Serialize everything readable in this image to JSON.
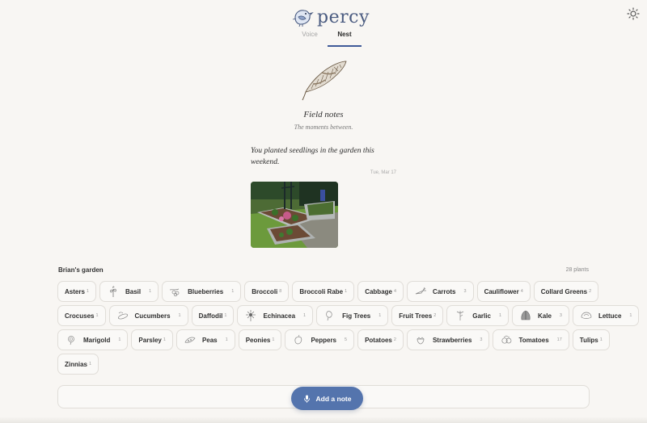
{
  "app": {
    "name": "percy"
  },
  "tabs": [
    {
      "label": "Voice",
      "active": false
    },
    {
      "label": "Nest",
      "active": true
    }
  ],
  "field_notes": {
    "title": "Field notes",
    "subtitle": "The moments between."
  },
  "note": {
    "text": "You planted seedlings in the garden this weekend.",
    "date": "Tue, Mar 17"
  },
  "garden": {
    "title": "Brian's garden",
    "count": "28 plants",
    "plants": [
      {
        "name": "Asters",
        "count": "1",
        "icon": null
      },
      {
        "name": "Basil",
        "count": "1",
        "icon": "basil-icon"
      },
      {
        "name": "Blueberries",
        "count": "1",
        "icon": "blueberries-icon"
      },
      {
        "name": "Broccoli",
        "count": "8",
        "icon": null
      },
      {
        "name": "Broccoli Rabe",
        "count": "1",
        "icon": null
      },
      {
        "name": "Cabbage",
        "count": "4",
        "icon": null
      },
      {
        "name": "Carrots",
        "count": "3",
        "icon": "carrots-icon"
      },
      {
        "name": "Cauliflower",
        "count": "4",
        "icon": null
      },
      {
        "name": "Collard Greens",
        "count": "2",
        "icon": null
      },
      {
        "name": "Crocuses",
        "count": "1",
        "icon": null
      },
      {
        "name": "Cucumbers",
        "count": "1",
        "icon": "cucumbers-icon"
      },
      {
        "name": "Daffodil",
        "count": "1",
        "icon": null
      },
      {
        "name": "Echinacea",
        "count": "1",
        "icon": "echinacea-icon"
      },
      {
        "name": "Fig Trees",
        "count": "1",
        "icon": "fig-trees-icon"
      },
      {
        "name": "Fruit Trees",
        "count": "2",
        "icon": null
      },
      {
        "name": "Garlic",
        "count": "1",
        "icon": "garlic-icon"
      },
      {
        "name": "Kale",
        "count": "3",
        "icon": "kale-icon"
      },
      {
        "name": "Lettuce",
        "count": "1",
        "icon": "lettuce-icon"
      },
      {
        "name": "Marigold",
        "count": "1",
        "icon": "marigold-icon"
      },
      {
        "name": "Parsley",
        "count": "1",
        "icon": null
      },
      {
        "name": "Peas",
        "count": "1",
        "icon": "peas-icon"
      },
      {
        "name": "Peonies",
        "count": "1",
        "icon": null
      },
      {
        "name": "Peppers",
        "count": "5",
        "icon": "peppers-icon"
      },
      {
        "name": "Potatoes",
        "count": "2",
        "icon": null
      },
      {
        "name": "Strawberries",
        "count": "3",
        "icon": "strawberries-icon"
      },
      {
        "name": "Tomatoes",
        "count": "17",
        "icon": "tomatoes-icon"
      },
      {
        "name": "Tulips",
        "count": "1",
        "icon": null
      },
      {
        "name": "Zinnias",
        "count": "1",
        "icon": null
      }
    ]
  },
  "composer": {
    "button_label": "Add a note",
    "icon": "microphone-icon"
  },
  "colors": {
    "accent": "#5474ad",
    "brand": "#4a5b80",
    "background": "#f8f6f3"
  }
}
